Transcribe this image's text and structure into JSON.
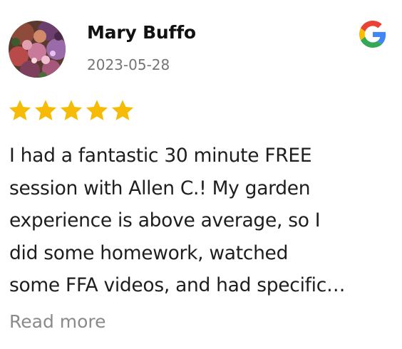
{
  "review": {
    "reviewer_name": "Mary Buffo",
    "date": "2023-05-28",
    "rating": 5,
    "rating_max": 5,
    "text_lines": [
      "I had a fantastic 30 minute FREE",
      "session with Allen C.! My garden",
      "experience is above average, so I",
      "did some homework, watched",
      "some FFA videos, and had specific…"
    ],
    "read_more_label": "Read more"
  },
  "icons": {
    "source": "google-g-icon",
    "star": "star-icon",
    "avatar": "avatar-flowers-photo"
  },
  "colors": {
    "star": "#F6BB06",
    "google_blue": "#4285F4",
    "google_red": "#EA4335",
    "google_yellow": "#FBBC05",
    "google_green": "#34A853",
    "secondary_text": "#757575",
    "read_more": "#8A8A8A"
  }
}
